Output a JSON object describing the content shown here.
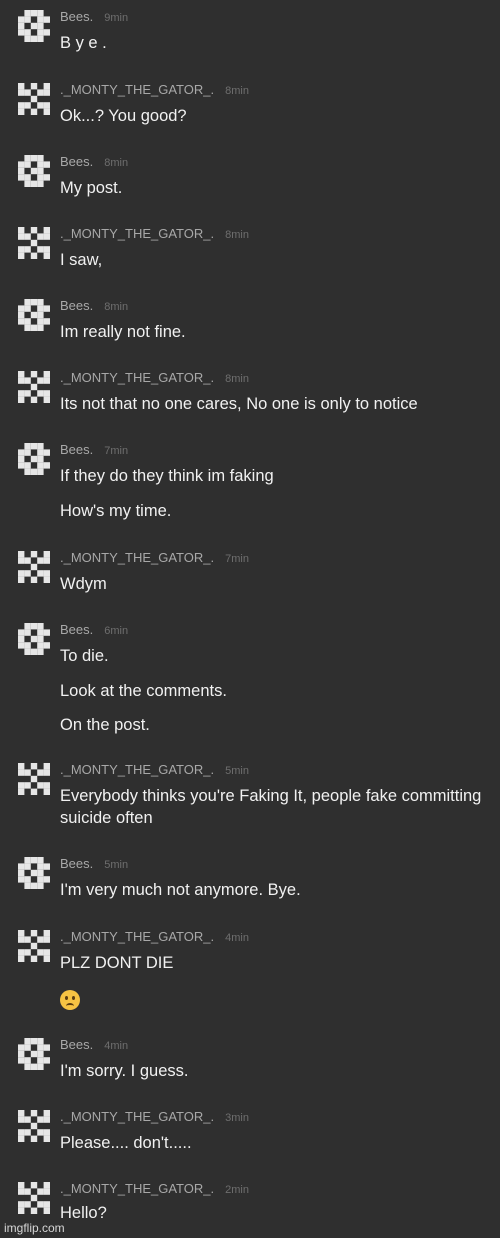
{
  "users": {
    "bees": "Bees.",
    "monty": "._MONTY_THE_GATOR_."
  },
  "messages": [
    {
      "user": "Bees.",
      "time": "9min",
      "lines": [
        "B y e ."
      ]
    },
    {
      "user": "._MONTY_THE_GATOR_.",
      "time": "8min",
      "lines": [
        "Ok...? You good?"
      ]
    },
    {
      "user": "Bees.",
      "time": "8min",
      "lines": [
        "My post."
      ]
    },
    {
      "user": "._MONTY_THE_GATOR_.",
      "time": "8min",
      "lines": [
        "I saw,"
      ]
    },
    {
      "user": "Bees.",
      "time": "8min",
      "lines": [
        "Im really not fine."
      ]
    },
    {
      "user": "._MONTY_THE_GATOR_.",
      "time": "8min",
      "lines": [
        "Its not that no one cares, No one is only to notice"
      ]
    },
    {
      "user": "Bees.",
      "time": "7min",
      "lines": [
        "If they do they think im faking",
        "How's my time."
      ]
    },
    {
      "user": "._MONTY_THE_GATOR_.",
      "time": "7min",
      "lines": [
        "Wdym"
      ]
    },
    {
      "user": "Bees.",
      "time": "6min",
      "lines": [
        "To die.",
        "Look at the comments.",
        "On the post."
      ]
    },
    {
      "user": "._MONTY_THE_GATOR_.",
      "time": "5min",
      "lines": [
        "Everybody thinks you're Faking It, people fake committing suicide often"
      ]
    },
    {
      "user": "Bees.",
      "time": "5min",
      "lines": [
        "I'm very much not anymore. Bye."
      ]
    },
    {
      "user": "._MONTY_THE_GATOR_.",
      "time": "4min",
      "lines": [
        "PLZ DONT DIE"
      ],
      "emoji": "worried-face"
    },
    {
      "user": "Bees.",
      "time": "4min",
      "lines": [
        "I'm sorry. I guess."
      ]
    },
    {
      "user": "._MONTY_THE_GATOR_.",
      "time": "3min",
      "lines": [
        "Please.... don't....."
      ]
    },
    {
      "user": "._MONTY_THE_GATOR_.",
      "time": "2min",
      "lines": [
        "Hello?"
      ]
    }
  ],
  "watermark": "imgflip.com"
}
